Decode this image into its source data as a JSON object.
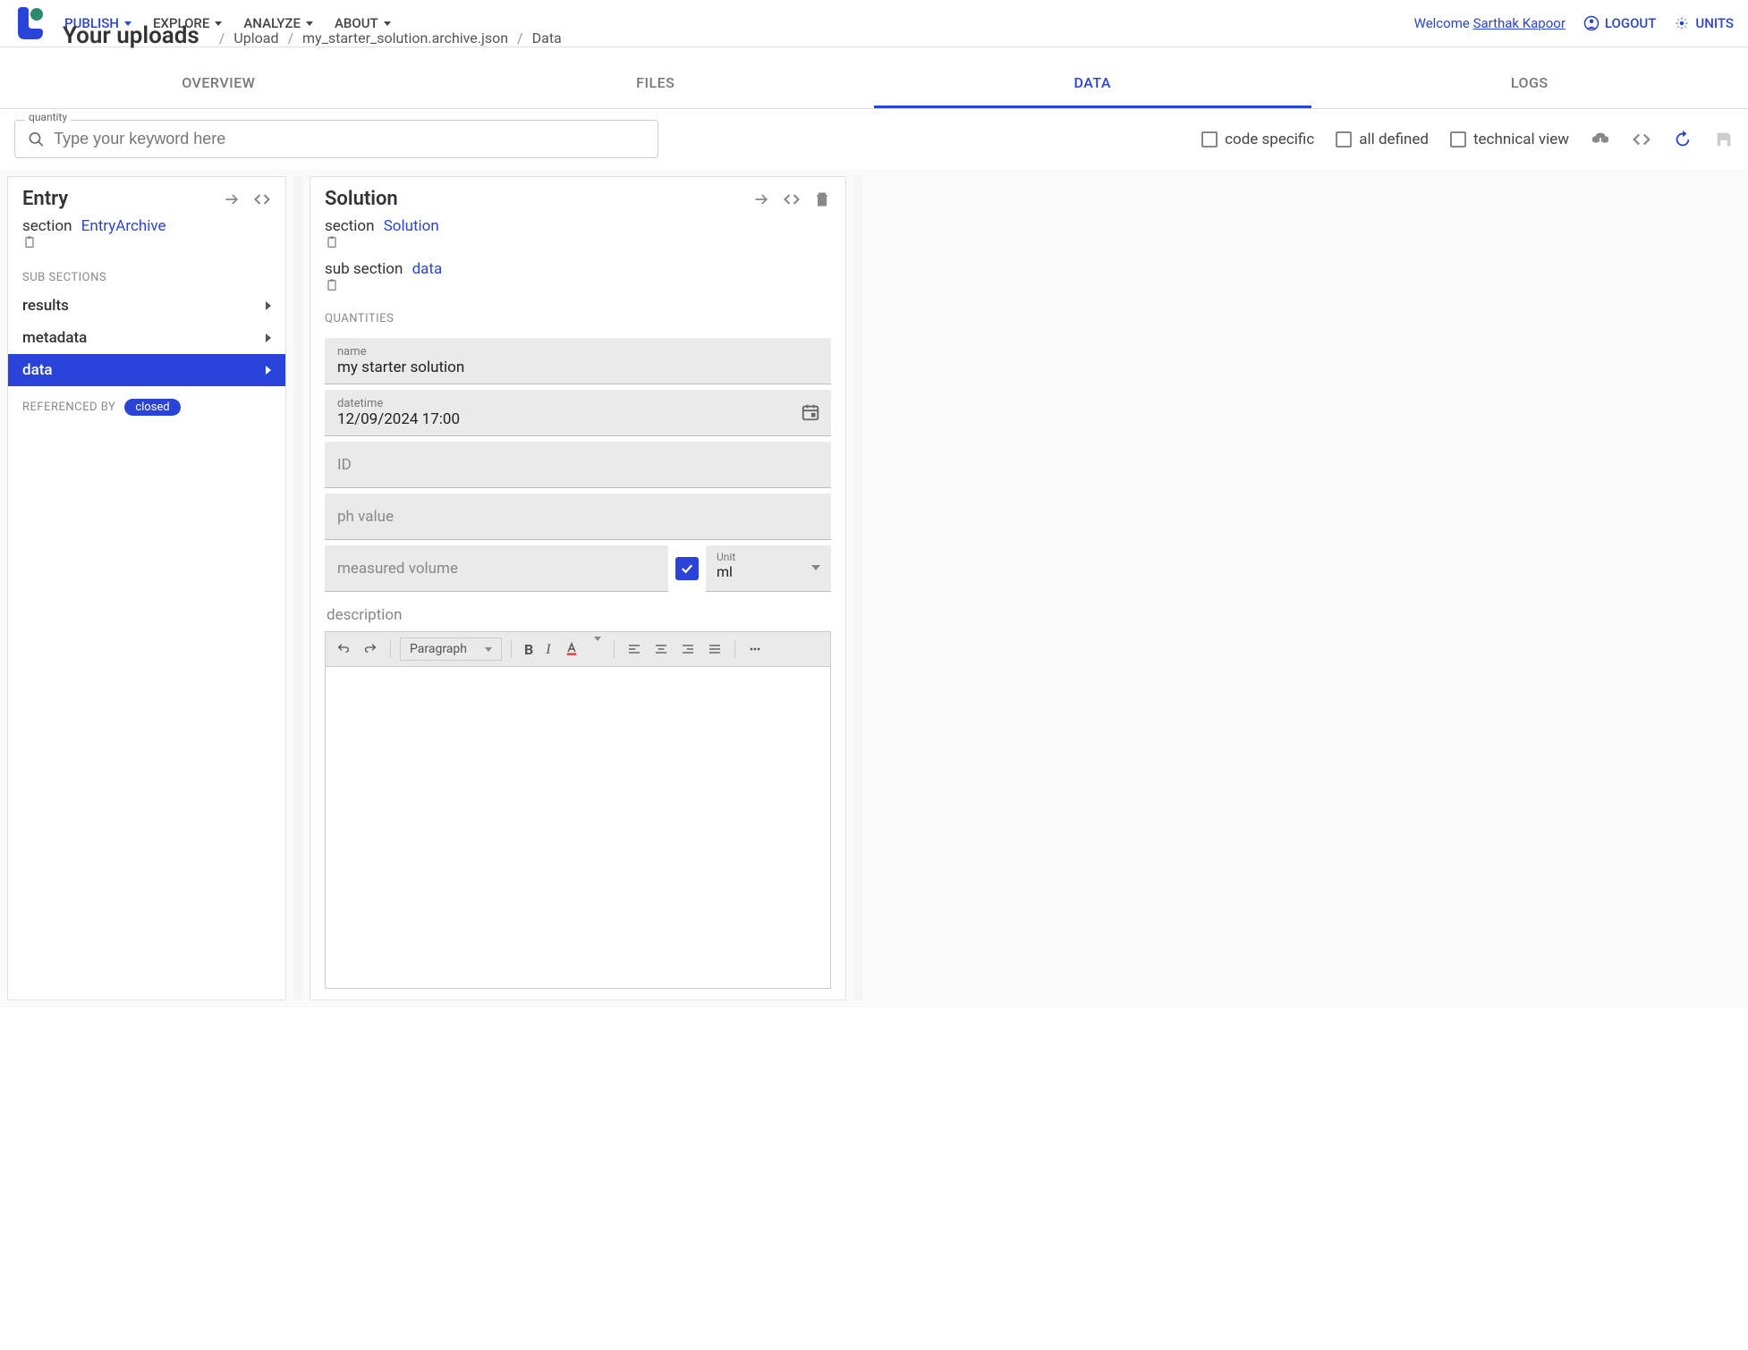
{
  "nav": {
    "publish": "PUBLISH",
    "explore": "EXPLORE",
    "analyze": "ANALYZE",
    "about": "ABOUT"
  },
  "header": {
    "welcome": "Welcome",
    "user": "Sarthak Kapoor",
    "logout": "LOGOUT",
    "units": "UNITS"
  },
  "breadcrumb": {
    "title": "Your uploads",
    "parts": [
      "Upload",
      "my_starter_solution.archive.json",
      "Data"
    ]
  },
  "tabs": {
    "overview": "OVERVIEW",
    "files": "FILES",
    "data": "DATA",
    "logs": "LOGS"
  },
  "search": {
    "label": "quantity",
    "placeholder": "Type your keyword here"
  },
  "checkboxes": {
    "code_specific": "code specific",
    "all_defined": "all defined",
    "technical_view": "technical view"
  },
  "entry_panel": {
    "title": "Entry",
    "section_label": "section",
    "section_link": "EntryArchive",
    "subsections_label": "SUB SECTIONS",
    "subsections": [
      "results",
      "metadata",
      "data"
    ],
    "referenced_label": "REFERENCED BY",
    "chip": "closed"
  },
  "solution_panel": {
    "title": "Solution",
    "section_label": "section",
    "section_link": "Solution",
    "subsection_label": "sub section",
    "subsection_link": "data",
    "quantities_label": "QUANTITIES",
    "fields": {
      "name_label": "name",
      "name_value": "my starter solution",
      "datetime_label": "datetime",
      "datetime_value": "12/09/2024 17:00",
      "id_placeholder": "ID",
      "ph_placeholder": "ph value",
      "volume_placeholder": "measured volume",
      "unit_label": "Unit",
      "unit_value": "ml",
      "description_label": "description"
    },
    "editor": {
      "paragraph": "Paragraph"
    }
  }
}
